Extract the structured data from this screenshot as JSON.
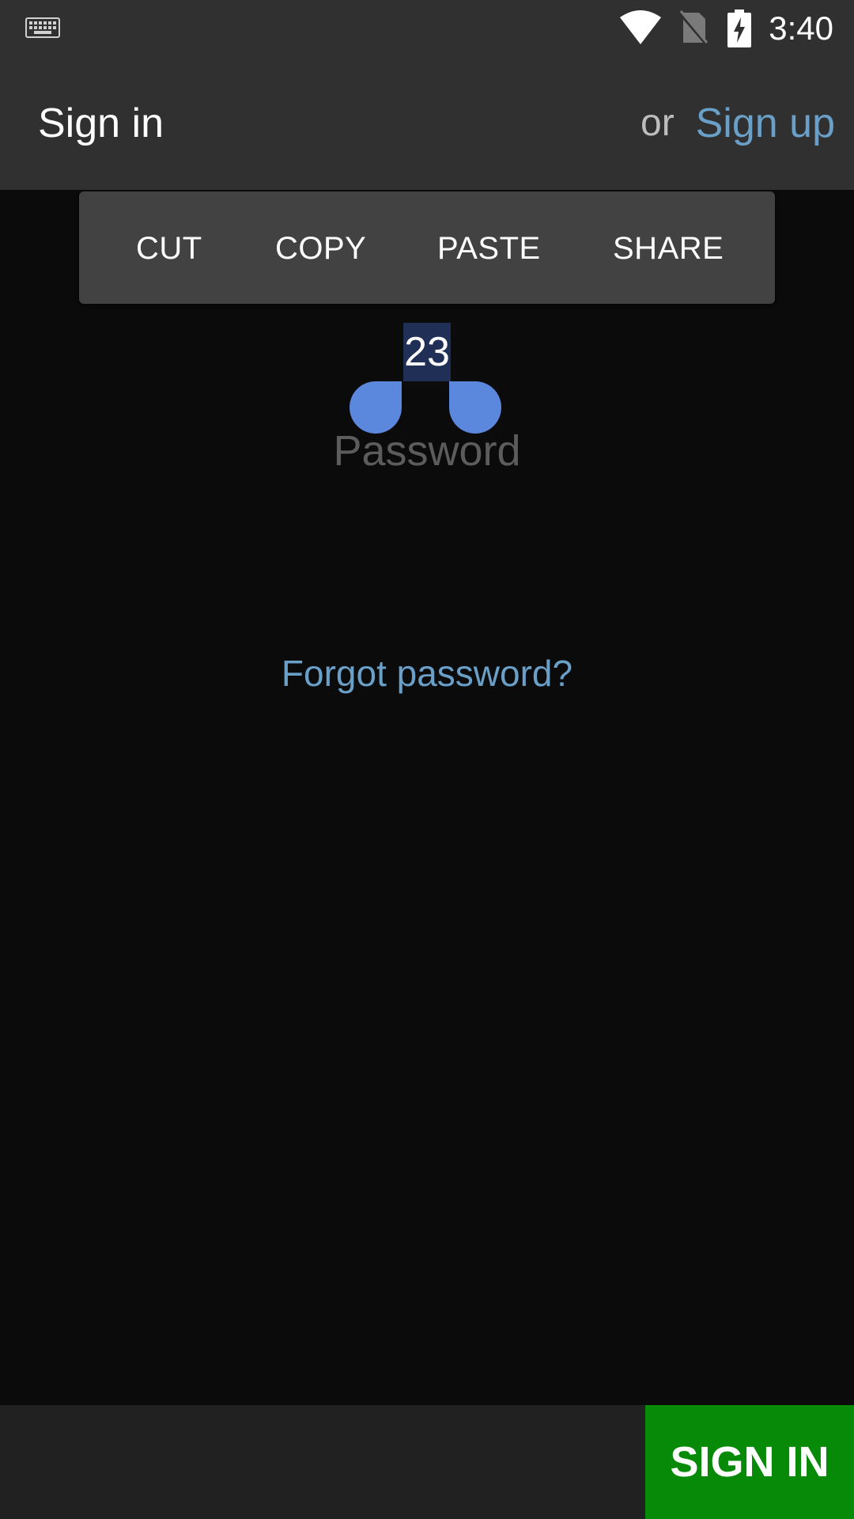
{
  "status_bar": {
    "time": "3:40",
    "icons": [
      "keyboard-icon",
      "wifi-icon",
      "no-sim-icon",
      "battery-charging-icon"
    ]
  },
  "app_bar": {
    "title": "Sign in",
    "or_text": "or",
    "signup_label": "Sign up"
  },
  "selection_toolbar": {
    "actions": [
      "CUT",
      "COPY",
      "PASTE",
      "SHARE"
    ]
  },
  "password_field": {
    "selected_text": "23",
    "placeholder": "Password"
  },
  "forgot_password_label": "Forgot password?",
  "bottom_bar": {
    "signin_label": "SIGN IN"
  },
  "colors": {
    "status_bar_bg": "#303030",
    "app_bar_bg": "#303030",
    "background": "#0b0b0c",
    "link": "#6a9fc8",
    "toolbar_bg": "#424242",
    "selection_handle": "#5b87dd",
    "selection_highlight": "#1f2f55",
    "signin_button": "#078a07",
    "bottom_bar_bg": "#212121"
  }
}
